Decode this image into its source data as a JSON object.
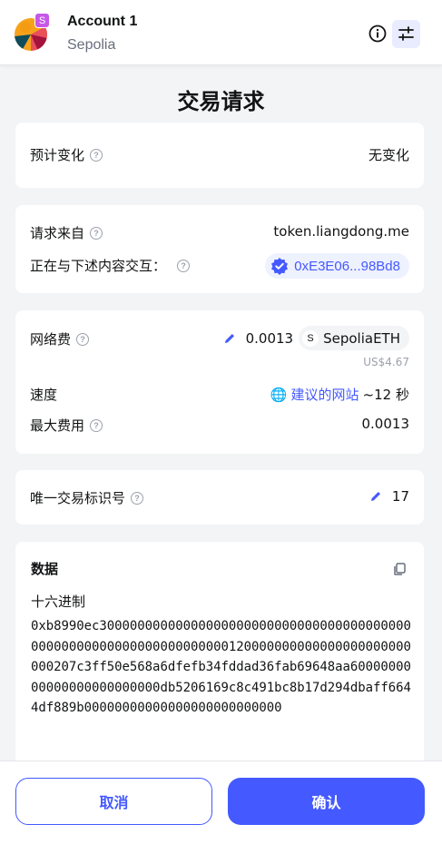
{
  "header": {
    "account_name": "Account 1",
    "network_name": "Sepolia",
    "network_badge": "S",
    "info_icon": "info-icon",
    "settings_icon": "sliders-icon"
  },
  "page_title": "交易请求",
  "estimated_changes": {
    "label": "预计变化",
    "value": "无变化"
  },
  "request": {
    "from_label": "请求来自",
    "from_value": "token.liangdong.me",
    "interacting_label": "正在与下述内容交互：",
    "address": "0xE3E06...98Bd8"
  },
  "fees": {
    "network_fee_label": "网络费",
    "network_fee_amount": "0.0013",
    "token_badge": "S",
    "token_name": "SepoliaETH",
    "fiat_value": "US$4.67",
    "speed_label": "速度",
    "speed_emoji": "🌐",
    "speed_site": "建议的网站",
    "speed_time": "~12 秒",
    "max_fee_label": "最大费用",
    "max_fee_value": "0.0013"
  },
  "nonce": {
    "label": "唯一交易标识号",
    "value": "17"
  },
  "data": {
    "title": "数据",
    "hex_label": "十六进制",
    "hex_value": "0xb8990ec3000000000000000000000000000000000000000000000000000000000000000000120000000000000000000000000207c3ff50e568a6dfefb34fddad36fab69648aa6000000000000000000000000db5206169c8c491bc8b17d294dbaff6644df889b00000000000000000000000000"
  },
  "footer": {
    "cancel_label": "取消",
    "confirm_label": "确认"
  },
  "colors": {
    "accent": "#4459ff",
    "background": "#f2f4f6",
    "muted": "#686e7d"
  }
}
